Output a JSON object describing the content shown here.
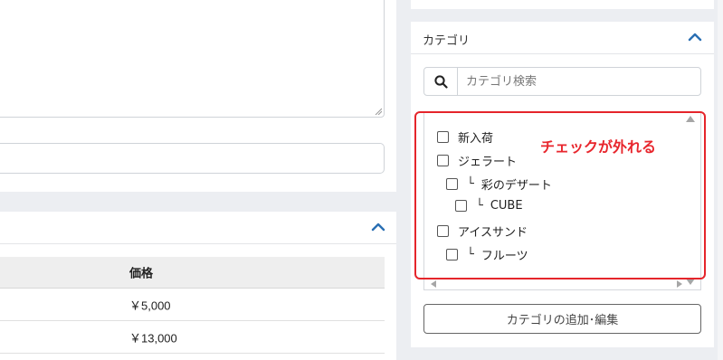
{
  "left": {
    "textarea_value": "",
    "text_input_value": "",
    "table": {
      "header": "価格",
      "rows": [
        {
          "price": "￥5,000"
        },
        {
          "price": "￥13,000"
        }
      ]
    }
  },
  "category_panel": {
    "title": "カテゴリ",
    "search_placeholder": "カテゴリ検索",
    "items": [
      {
        "label": "新入荷",
        "level": 0,
        "checked": false
      },
      {
        "label": "ジェラート",
        "level": 0,
        "checked": false
      },
      {
        "label": "彩のデザート",
        "level": 1,
        "checked": false
      },
      {
        "label": "CUBE",
        "level": 2,
        "checked": false
      },
      {
        "label": "アイスサンド",
        "level": 0,
        "checked": false
      },
      {
        "label": "フルーツ",
        "level": 1,
        "checked": false
      }
    ],
    "branch_glyph": "└",
    "add_edit_button": "カテゴリの追加･編集"
  },
  "annotation": {
    "text": "チェックが外れる",
    "color": "#e8262d"
  },
  "colors": {
    "accent": "#2a6fb3",
    "annotation_red": "#e5252b"
  },
  "icons": [
    "search-icon",
    "chevron-up-icon",
    "resize-grip-icon"
  ]
}
